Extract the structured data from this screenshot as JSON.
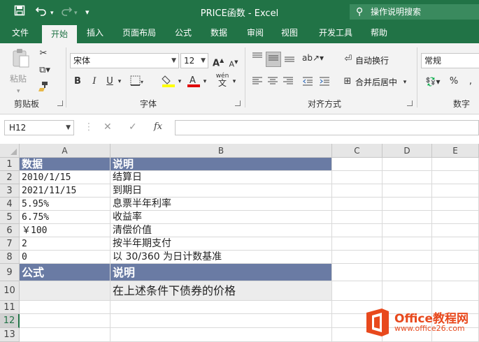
{
  "titlebar": {
    "title": "PRICE函数  -  Excel",
    "tell_me": "操作说明搜索"
  },
  "tabs": [
    "文件",
    "开始",
    "插入",
    "页面布局",
    "公式",
    "数据",
    "审阅",
    "视图",
    "开发工具",
    "帮助"
  ],
  "ribbon": {
    "clipboard_label": "剪贴板",
    "paste_label": "粘贴",
    "font_label": "字体",
    "font_name": "宋体",
    "font_size": "12",
    "bold": "B",
    "italic": "I",
    "underline": "U",
    "grow_font": "A",
    "shrink_font": "A",
    "phonetic": "wén",
    "align_label": "对齐方式",
    "wrap_text": "自动换行",
    "merge_center": "合并后居中",
    "number_label": "数字",
    "number_format": "常规",
    "percent": "%"
  },
  "formula_bar": {
    "name_box": "H12",
    "fx": "fx",
    "value": ""
  },
  "columns": [
    "A",
    "B",
    "C",
    "D",
    "E"
  ],
  "rows": [
    "1",
    "2",
    "3",
    "4",
    "5",
    "6",
    "7",
    "8",
    "9",
    "10",
    "11",
    "12",
    "13"
  ],
  "cells": {
    "A1": "数据",
    "B1": "说明",
    "A2": "2010/1/15",
    "B2": "结算日",
    "A3": "2021/11/15",
    "B3": "到期日",
    "A4": "5.95%",
    "B4": "息票半年利率",
    "A5": "6.75%",
    "B5": "收益率",
    "A6": "￥100",
    "B6": "清偿价值",
    "A7": "2",
    "B7": "按半年期支付",
    "A8": "0",
    "B8": "以 30/360 为日计数基准",
    "A9": "公式",
    "B9": "说明",
    "A10": "",
    "B10": "在上述条件下债券的价格"
  },
  "watermark": {
    "brand": "Office教程网",
    "url": "www.office26.com"
  },
  "colors": {
    "excel_green": "#217346",
    "header_band": "#6a7ba4",
    "sub_band": "#ececec",
    "logo_orange": "#e8491d"
  }
}
